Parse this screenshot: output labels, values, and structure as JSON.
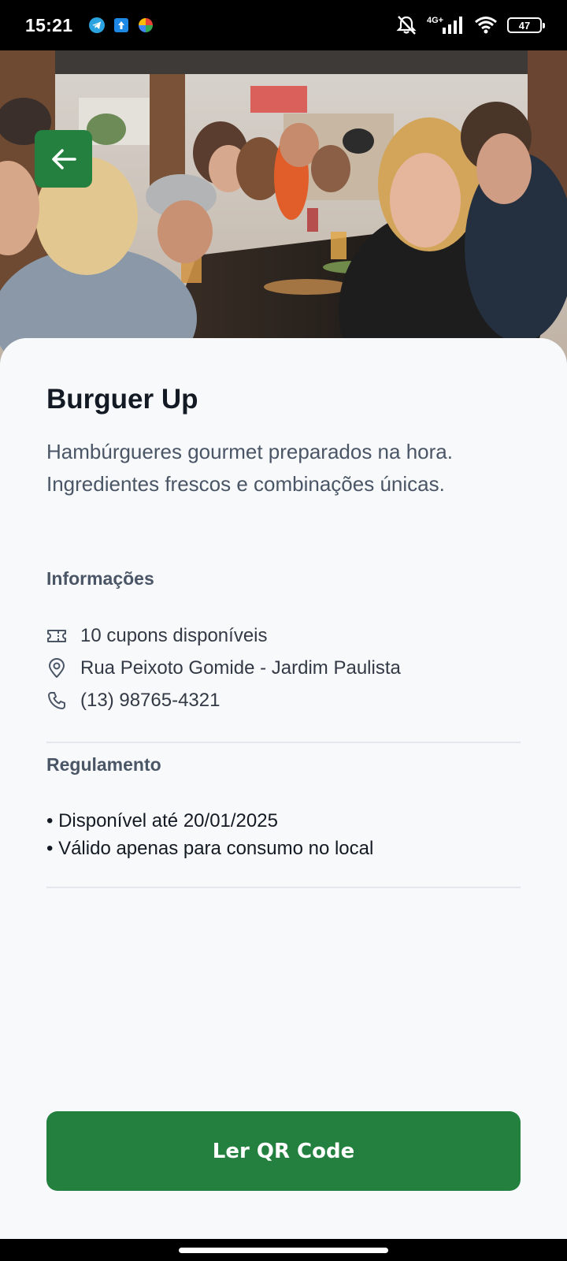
{
  "status_bar": {
    "time": "15:21",
    "network": "4G+",
    "battery": "47"
  },
  "restaurant": {
    "name": "Burguer Up",
    "description": "Hambúrgueres gourmet preparados na hora. Ingredientes frescos e combinações únicas."
  },
  "info": {
    "heading": "Informações",
    "items": [
      {
        "icon": "ticket-icon",
        "text": "10 cupons disponíveis"
      },
      {
        "icon": "location-pin-icon",
        "text": "Rua Peixoto Gomide - Jardim Paulista"
      },
      {
        "icon": "phone-icon",
        "text": "(13) 98765-4321"
      }
    ]
  },
  "rules": {
    "heading": "Regulamento",
    "items": [
      "• Disponível até 20/01/2025",
      "• Válido apenas para consumo no local"
    ]
  },
  "actions": {
    "qr_label": "Ler QR Code"
  },
  "colors": {
    "accent": "#24803f",
    "background": "#f8f9fb",
    "title": "#141a23",
    "muted": "#4a5566"
  }
}
